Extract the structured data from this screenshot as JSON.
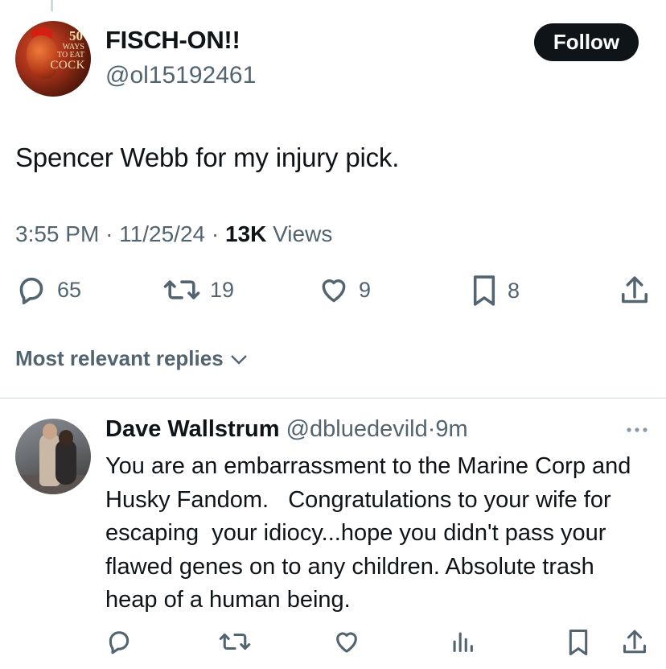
{
  "tweet": {
    "author": {
      "name": "FISCH-ON!!",
      "handle": "@ol15192461",
      "avatar_cover": {
        "number": "50",
        "line1": "WAYS",
        "line2": "TO EAT",
        "line3": "COCK"
      }
    },
    "follow_label": "Follow",
    "text": "Spencer Webb for my injury pick.",
    "time": "3:55 PM",
    "separator": "·",
    "date": "11/25/24",
    "views_count": "13K",
    "views_label": "Views",
    "stats": {
      "replies": "65",
      "reposts": "19",
      "likes": "9",
      "bookmarks": "8"
    }
  },
  "replies_sort": {
    "label": "Most relevant replies"
  },
  "reply": {
    "name": "Dave Wallstrum",
    "handle": "@dbluedevild",
    "separator": "·",
    "age": "9m",
    "text": "You are an embarrassment to the Marine Corp and Husky Fandom.   Congratulations to your wife for escaping  your idiocy...hope you didn't pass your flawed genes on to any children. Absolute trash heap of a human being."
  },
  "icons": {
    "reply": "reply-icon",
    "repost": "repost-icon",
    "like": "heart-icon",
    "bookmark": "bookmark-icon",
    "share": "share-icon",
    "analytics": "analytics-icon",
    "more": "more-icon",
    "chevron": "chevron-down-icon"
  },
  "colors": {
    "text": "#0f1419",
    "secondary": "#536471",
    "button_bg": "#0f1419",
    "divider": "#cfd9de"
  }
}
